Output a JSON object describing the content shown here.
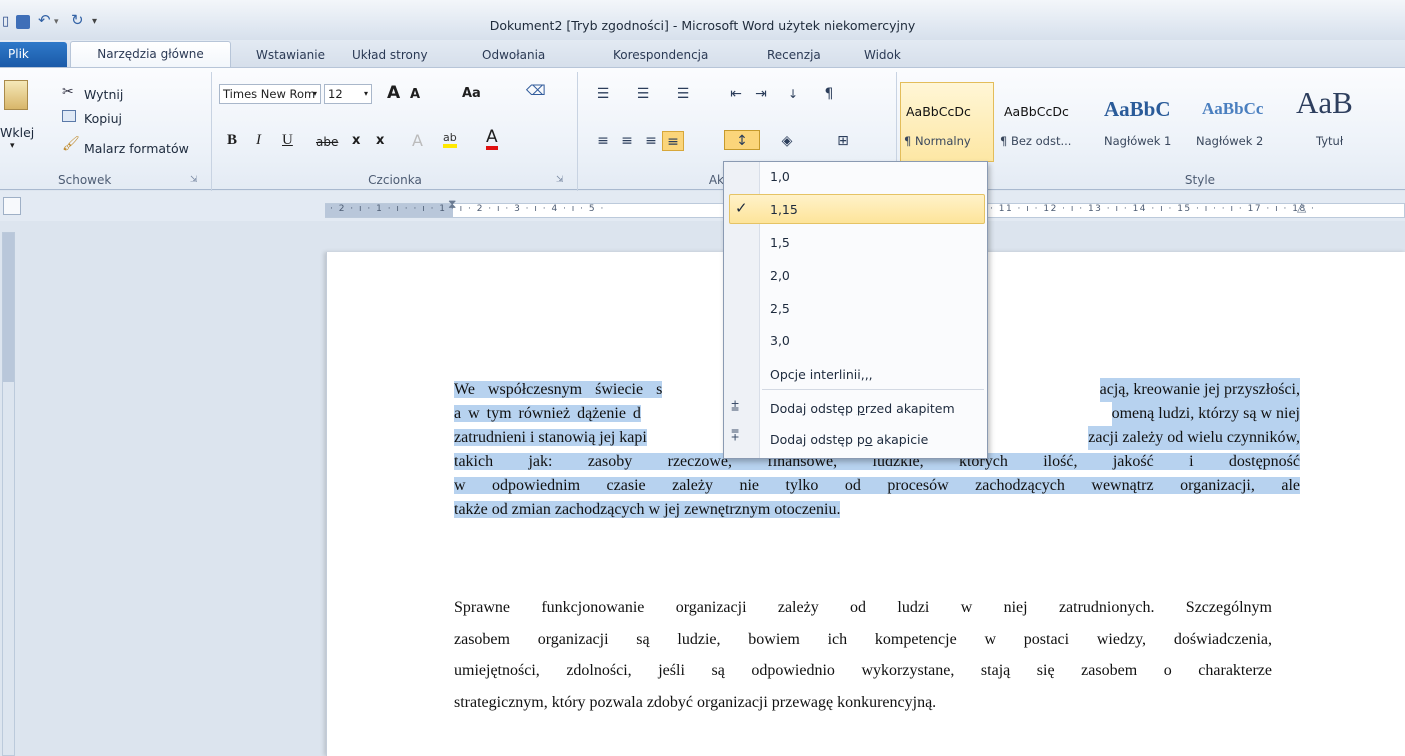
{
  "window": {
    "title": "Dokument2 [Tryb zgodności] - Microsoft Word użytek niekomercyjny"
  },
  "quick_access": {
    "save_icon": "save-icon",
    "undo_glyph": "↶",
    "redo_glyph": "↻",
    "customize_glyph": "▾"
  },
  "tabs": [
    {
      "label": "Plik"
    },
    {
      "label": "Narzędzia główne"
    },
    {
      "label": "Wstawianie"
    },
    {
      "label": "Układ strony"
    },
    {
      "label": "Odwołania"
    },
    {
      "label": "Korespondencja"
    },
    {
      "label": "Recenzja"
    },
    {
      "label": "Widok"
    }
  ],
  "clipboard": {
    "paste_label": "Wklej",
    "cut_label": "Wytnij",
    "copy_label": "Kopiuj",
    "format_painter_label": "Malarz formatów",
    "group_label": "Schowek"
  },
  "font": {
    "family": "Times New Rom",
    "size": "12",
    "grow_label": "A",
    "shrink_label": "A",
    "case_label": "Aa",
    "bold": "B",
    "italic": "I",
    "underline": "U",
    "strike": "abe",
    "subscript": "x",
    "superscript": "x",
    "highlight_label": "ab",
    "color_label": "A",
    "group_label": "Czcionka"
  },
  "paragraph": {
    "group_label": "Aka"
  },
  "styles": {
    "group_label": "Style",
    "items": [
      {
        "sample": "AaBbCcDc",
        "name": "¶ Normalny"
      },
      {
        "sample": "AaBbCcDc",
        "name": "¶ Bez odst..."
      },
      {
        "sample": "AaBbC",
        "name": "Nagłówek 1"
      },
      {
        "sample": "AaBbCc",
        "name": "Nagłówek 2"
      },
      {
        "sample": "AaB",
        "name": "Tytuł"
      }
    ]
  },
  "ruler": {
    "left_numbers": "· 2 · ı · 1 · ı ·   · ı · 1 · ı · 2 · ı · 3 · ı · 4 · ı · 5 ·",
    "right_numbers": "· 11 · ı · 12 · ı · 13 · ı · 14 · ı · 15 · ı ·   · ı · 17 · ı · 18 ·"
  },
  "line_spacing_menu": {
    "options": [
      "1,0",
      "1,15",
      "1,5",
      "2,0",
      "2,5",
      "3,0"
    ],
    "selected": "1,15",
    "check_glyph": "✓",
    "line_options_label": "Opcje interlinii,,,",
    "add_before": {
      "prefix": "Dodaj odstęp ",
      "accel": "p",
      "suffix": "rzed akapitem"
    },
    "add_after": {
      "prefix": "Dodaj odstęp p",
      "accel": "o",
      "suffix": " akapicie"
    }
  },
  "document": {
    "paragraph1_lines": [
      "We współczesnym świecie s",
      "acją, kreowanie jej przyszłości,",
      "a w tym również dążenie d",
      "omeną ludzi, którzy są w niej",
      "zatrudnieni i stanowią jej kapi",
      "zacji zależy od wielu czynników,",
      "takich jak: zasoby rzeczowe, finansowe, ludzkie, których ilość, jakość i dostępność",
      "w odpowiednim czasie zależy nie tylko od procesów zachodzących wewnątrz organizacji, ale",
      "także od zmian zachodzących w jej zewnętrznym otoczeniu."
    ],
    "paragraph2_lines": [
      "Sprawne funkcjonowanie organizacji zależy od ludzi w niej zatrudnionych. Szczególnym",
      "zasobem organizacji są ludzie, bowiem ich kompetencje w postaci wiedzy, doświadczenia,",
      "umiejętności, zdolności, jeśli są odpowiednio wykorzystane, stają się zasobem o charakterze",
      "strategicznym, który pozwala zdobyć organizacji przewagę konkurencyjną."
    ]
  }
}
